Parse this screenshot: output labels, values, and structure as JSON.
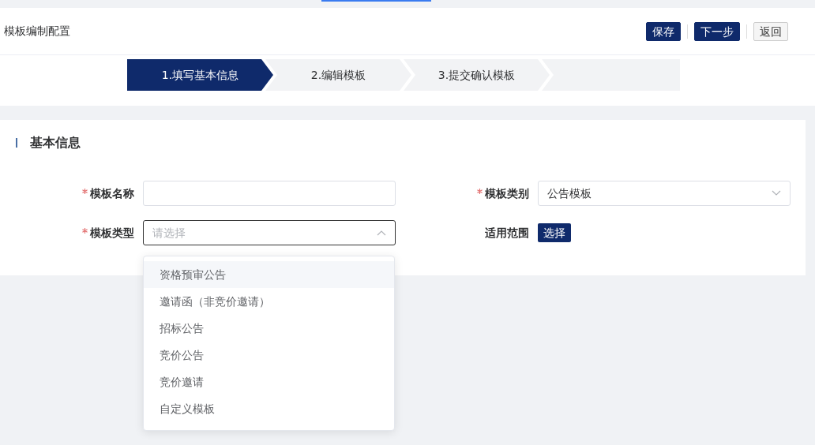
{
  "header": {
    "title": "模板编制配置",
    "buttons": [
      {
        "label": "保存",
        "kind": "primary"
      },
      {
        "label": "下一步",
        "kind": "primary"
      },
      {
        "label": "返回",
        "kind": "default"
      }
    ]
  },
  "steps": [
    {
      "label": "1.填写基本信息",
      "selected": true
    },
    {
      "label": "2.编辑模板",
      "selected": false
    },
    {
      "label": "3.提交确认模板",
      "selected": false
    }
  ],
  "section": {
    "title": "基本信息"
  },
  "fields": [
    {
      "kind": "text",
      "label": "模板名称",
      "required": true
    },
    {
      "kind": "select",
      "label": "模板类别",
      "required": true,
      "value": "公告模板",
      "expanded": false
    },
    {
      "kind": "select",
      "label": "模板类型",
      "required": true,
      "placeholder": "请选择",
      "expanded": true,
      "options": [
        {
          "label": "资格预审公告",
          "highlighted": true
        },
        {
          "label": "邀请函（非竞价邀请）",
          "highlighted": false
        },
        {
          "label": "招标公告",
          "highlighted": false
        },
        {
          "label": "竞价公告",
          "highlighted": false
        },
        {
          "label": "竞价邀请",
          "highlighted": false
        },
        {
          "label": "自定义模板",
          "highlighted": false
        }
      ]
    },
    {
      "kind": "button",
      "label": "适用范围",
      "required": false,
      "button": "选择"
    }
  ]
}
